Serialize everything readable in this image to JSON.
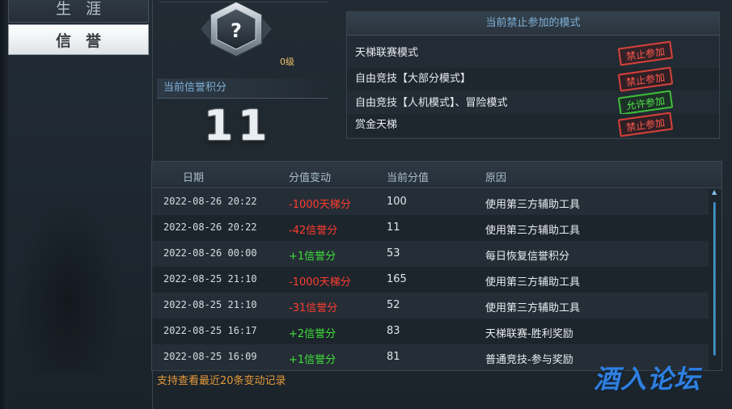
{
  "sidebar": {
    "tabs": [
      {
        "label": "生涯"
      },
      {
        "label": "信誉"
      }
    ]
  },
  "credit": {
    "level": "0级",
    "score_label": "当前信誉积分",
    "score": "11",
    "badge_symbol": "?"
  },
  "modes": {
    "title": "当前禁止参加的模式",
    "items": [
      {
        "name": "天梯联赛模式",
        "status": "禁止参加",
        "allowed": false
      },
      {
        "name": "自由竞技【大部分模式】",
        "status": "禁止参加",
        "allowed": false
      },
      {
        "name": "自由竞技【人机模式】、冒险模式",
        "status": "允许参加",
        "allowed": true
      },
      {
        "name": "赏金天梯",
        "status": "禁止参加",
        "allowed": false
      }
    ]
  },
  "log": {
    "headers": {
      "date": "日期",
      "change": "分值变动",
      "score": "当前分值",
      "reason": "原因"
    },
    "rows": [
      {
        "date": "2022-08-26 20:22",
        "change": "-1000天梯分",
        "score": "100",
        "reason": "使用第三方辅助工具",
        "positive": false
      },
      {
        "date": "2022-08-26 20:22",
        "change": "-42信誉分",
        "score": "11",
        "reason": "使用第三方辅助工具",
        "positive": false
      },
      {
        "date": "2022-08-26 00:00",
        "change": "+1信誉分",
        "score": "53",
        "reason": "每日恢复信誉积分",
        "positive": true
      },
      {
        "date": "2022-08-25 21:10",
        "change": "-1000天梯分",
        "score": "165",
        "reason": "使用第三方辅助工具",
        "positive": false
      },
      {
        "date": "2022-08-25 21:10",
        "change": "-31信誉分",
        "score": "52",
        "reason": "使用第三方辅助工具",
        "positive": false
      },
      {
        "date": "2022-08-25 16:17",
        "change": "+2信誉分",
        "score": "83",
        "reason": "天梯联赛-胜利奖励",
        "positive": true
      },
      {
        "date": "2022-08-25 16:09",
        "change": "+1信誉分",
        "score": "81",
        "reason": "普通竞技-参与奖励",
        "positive": true
      }
    ],
    "footer_note": "支持查看最近20条变动记录"
  },
  "watermark": {
    "text": "酒入论坛"
  },
  "colors": {
    "negative": "#ff3b30",
    "positive": "#3fe03a",
    "accent_blue": "#7fb0d6",
    "note_orange": "#e49a3a"
  }
}
